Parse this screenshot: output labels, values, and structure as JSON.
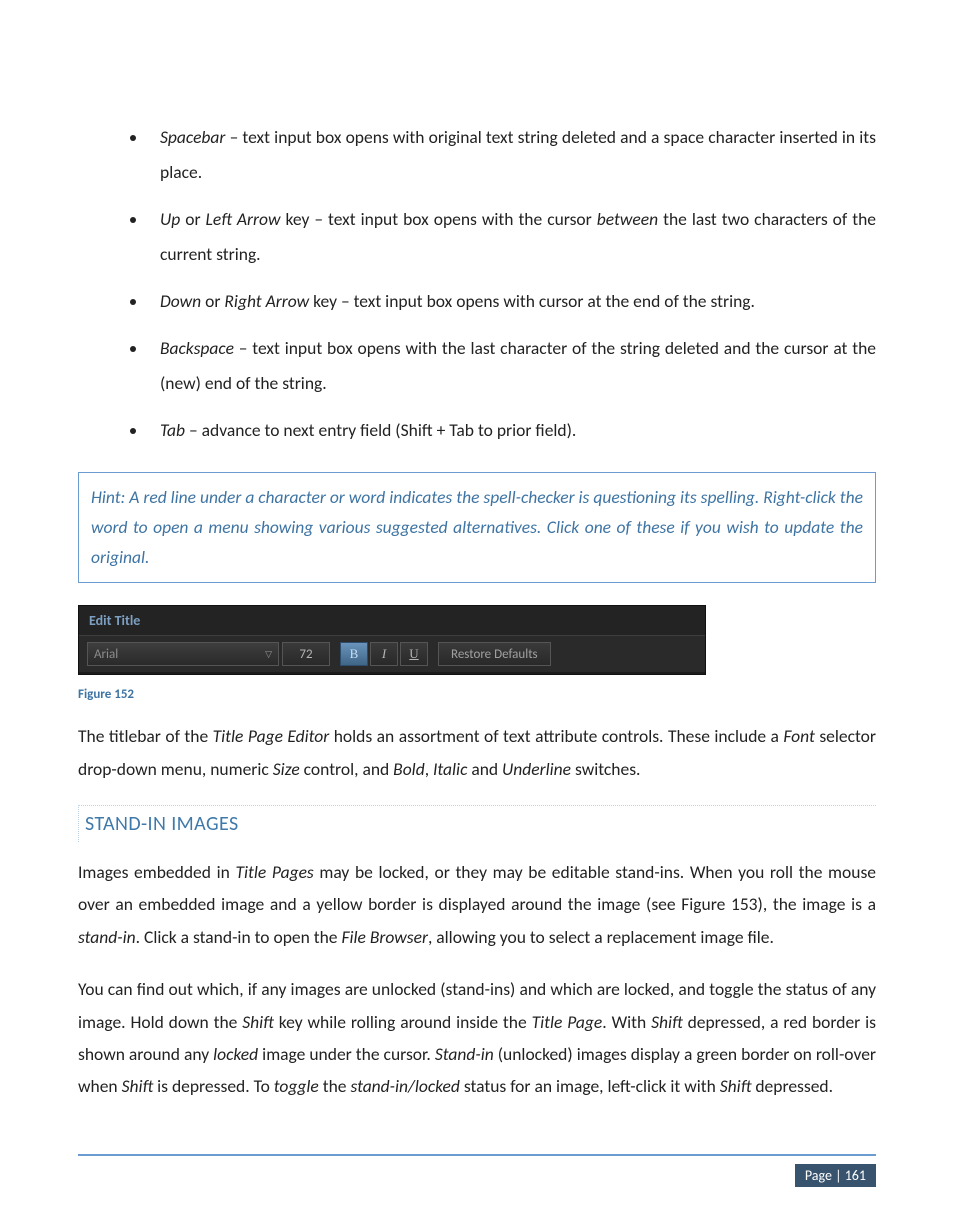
{
  "bullets": [
    {
      "term": "Spacebar",
      "rest": " – text input box opens with original text string deleted and a space character inserted in its place."
    },
    {
      "term": "Up",
      "mid": " or ",
      "term2": "Left Arrow",
      "rest": " key – text input box opens with the cursor ",
      "term3": "between",
      "rest2": " the last two characters of the current string."
    },
    {
      "term": "Down",
      "mid": " or ",
      "term2": "Right Arrow",
      "rest": " key – text input box opens with cursor at the end of the string."
    },
    {
      "term": "Backspace",
      "rest": " – text input box opens with the last character of the string deleted and the cursor at the (new) end of the string."
    },
    {
      "term": "Tab",
      "rest": " – advance to next entry field (Shift + Tab to prior field)."
    }
  ],
  "hint": "Hint: A red line under a character or word indicates the spell-checker is questioning its spelling. Right-click the word to open a menu showing various suggested alternatives.  Click one of these if you wish to update the original.",
  "editbar": {
    "title": "Edit Title",
    "font": "Arial",
    "size": "72",
    "b": "B",
    "i": "I",
    "u": "U",
    "restore": "Restore Defaults"
  },
  "figcap": "Figure 152",
  "para1_a": "The titlebar of the ",
  "para1_em1": "Title Page Editor",
  "para1_b": " holds an assortment of text attribute controls.  These include a ",
  "para1_em2": "Font",
  "para1_c": " selector drop-down menu, numeric ",
  "para1_em3": "Size",
  "para1_d": " control, and ",
  "para1_em4": "Bold",
  "para1_e": ", ",
  "para1_em5": "Italic",
  "para1_f": " and ",
  "para1_em6": "Underline",
  "para1_g": " switches.",
  "section": "STAND-IN IMAGES",
  "para2_a": "Images embedded in ",
  "para2_em1": "Title Pages",
  "para2_b": " may be locked, or they may be editable stand-ins.  When you roll the mouse over an embedded image and a yellow border is displayed around the image (see Figure 153), the image is a ",
  "para2_em2": "stand-in",
  "para2_c": ". Click a stand-in to open the ",
  "para2_em3": "File Browser",
  "para2_d": ", allowing you to select a replacement image file.",
  "para3_a": "You can find out which, if any images are unlocked (stand-ins) and which are locked, and toggle the status of any image.  Hold down the ",
  "para3_em1": "Shift",
  "para3_b": " key while rolling around inside the ",
  "para3_em2": "Title Page",
  "para3_c": ".  With ",
  "para3_em3": "Shift",
  "para3_d": " depressed, a red border is shown around any ",
  "para3_em4": "locked",
  "para3_e": " image under the cursor.  ",
  "para3_em5": "Stand-in",
  "para3_f": " (unlocked) images display a green border on roll-over when ",
  "para3_em6": "Shift",
  "para3_g": " is depressed.  To ",
  "para3_em7": "toggle",
  "para3_h": " the ",
  "para3_em8": "stand-in/locked",
  "para3_i": " status for an image, left-click it with ",
  "para3_em9": "Shift",
  "para3_j": " depressed.",
  "footer": "Page | 161"
}
